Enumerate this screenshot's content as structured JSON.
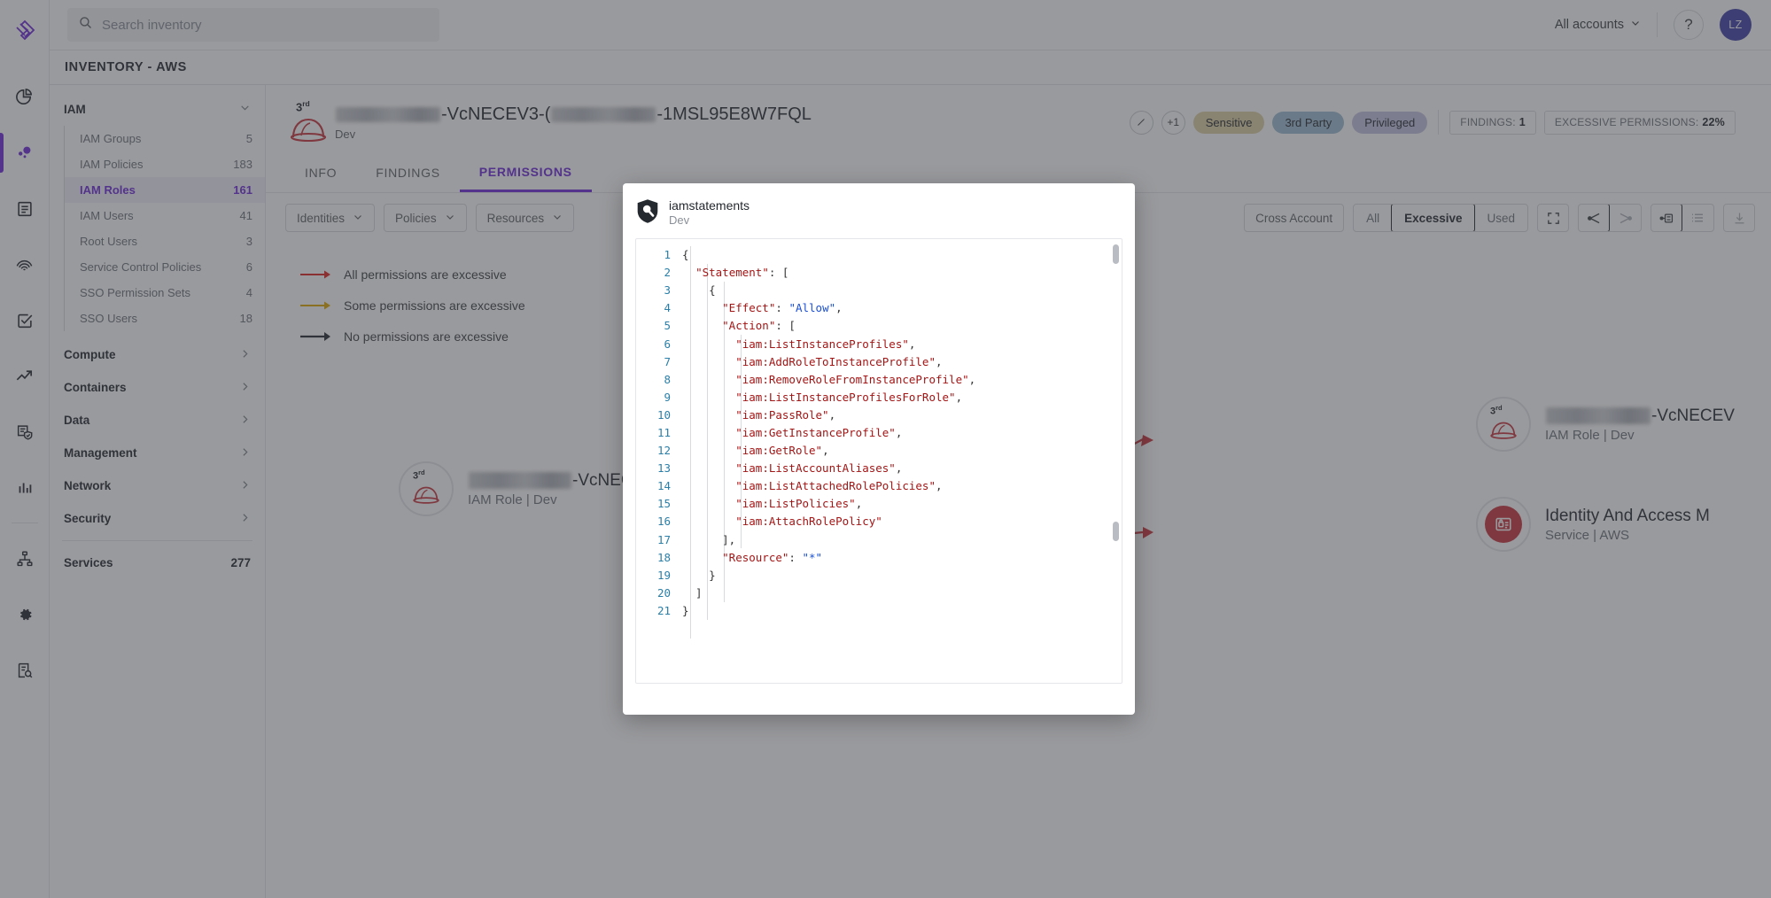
{
  "app": {
    "page_title": "INVENTORY - AWS",
    "logo_icon": "brand-logo-icon"
  },
  "search": {
    "placeholder": "Search inventory",
    "value": "",
    "icon": "search-icon"
  },
  "topbar": {
    "account_selector": "All accounts",
    "chevron_icon": "chevron-down-icon",
    "help_label": "?",
    "avatar_initials": "LZ"
  },
  "rail": {
    "items": [
      {
        "name": "pie-chart-icon",
        "active": false
      },
      {
        "name": "bubbles-icon",
        "active": true
      },
      {
        "name": "document-icon",
        "active": false
      },
      {
        "name": "fingerprint-icon",
        "active": false
      },
      {
        "name": "checkbox-icon",
        "active": false
      },
      {
        "name": "trending-up-icon",
        "active": false
      },
      {
        "name": "document-shield-icon",
        "active": false
      },
      {
        "name": "bar-chart-icon",
        "active": false
      },
      {
        "name": "sitemap-icon",
        "active": false
      },
      {
        "name": "gear-icon",
        "active": false
      },
      {
        "name": "document-search-icon",
        "active": false
      }
    ]
  },
  "sidebar": {
    "groups": [
      {
        "label": "IAM",
        "expanded": true,
        "chevron": "chevron-down-icon",
        "items": [
          {
            "label": "IAM Groups",
            "count": "5",
            "active": false
          },
          {
            "label": "IAM Policies",
            "count": "183",
            "active": false
          },
          {
            "label": "IAM Roles",
            "count": "161",
            "active": true
          },
          {
            "label": "IAM Users",
            "count": "41",
            "active": false
          },
          {
            "label": "Root Users",
            "count": "3",
            "active": false
          },
          {
            "label": "Service Control Policies",
            "count": "6",
            "active": false
          },
          {
            "label": "SSO Permission Sets",
            "count": "4",
            "active": false
          },
          {
            "label": "SSO Users",
            "count": "18",
            "active": false
          }
        ]
      },
      {
        "label": "Compute",
        "expanded": false,
        "chevron": "chevron-right-icon",
        "items": []
      },
      {
        "label": "Containers",
        "expanded": false,
        "chevron": "chevron-right-icon",
        "items": []
      },
      {
        "label": "Data",
        "expanded": false,
        "chevron": "chevron-right-icon",
        "items": []
      },
      {
        "label": "Management",
        "expanded": false,
        "chevron": "chevron-right-icon",
        "items": []
      },
      {
        "label": "Network",
        "expanded": false,
        "chevron": "chevron-right-icon",
        "items": []
      },
      {
        "label": "Security",
        "expanded": false,
        "chevron": "chevron-right-icon",
        "items": []
      }
    ],
    "footer": {
      "label": "Services",
      "count": "277"
    }
  },
  "entity": {
    "third_party_tag": "3rd",
    "icon": "third-party-role-icon",
    "name_part_1": "-VcNECEV3-",
    "name_part_2": "-1MSL95E8W7FQL",
    "subtitle": "Dev",
    "edit_icon": "pencil-icon",
    "more_count": "+1",
    "tags": [
      {
        "label": "Sensitive",
        "color": "#ded0a4"
      },
      {
        "label": "3rd Party",
        "color": "#9dbdd4"
      },
      {
        "label": "Privileged",
        "color": "#c5c3e4"
      }
    ],
    "stats": [
      {
        "label": "FINDINGS:",
        "value": "1"
      },
      {
        "label": "EXCESSIVE PERMISSIONS:",
        "value": "22%"
      }
    ]
  },
  "tabs": [
    {
      "label": "INFO",
      "active": false
    },
    {
      "label": "FINDINGS",
      "active": false
    },
    {
      "label": "PERMISSIONS",
      "active": true
    }
  ],
  "filters": {
    "dropdowns": [
      {
        "label": "Identities",
        "icon": "chevron-down-icon"
      },
      {
        "label": "Policies",
        "icon": "chevron-down-icon"
      },
      {
        "label": "Resources",
        "icon": "chevron-down-icon"
      }
    ],
    "cross_account": "Cross Account",
    "scope": [
      {
        "label": "All",
        "selected": false
      },
      {
        "label": "Excessive",
        "selected": true
      },
      {
        "label": "Used",
        "selected": false
      }
    ],
    "icons": [
      {
        "name": "expand-icon",
        "selected": false
      },
      {
        "name": "graph-fan-out-icon",
        "selected": true
      },
      {
        "name": "graph-fan-in-icon",
        "selected": false
      },
      {
        "name": "node-detail-icon",
        "selected": true
      },
      {
        "name": "list-view-icon",
        "selected": false
      },
      {
        "name": "download-icon",
        "selected": false
      }
    ]
  },
  "legend": [
    {
      "text": "All permissions are excessive",
      "color": "#e02020"
    },
    {
      "text": "Some permissions are excessive",
      "color": "#e0a800"
    },
    {
      "text": "No permissions are excessive",
      "color": "#24292f"
    }
  ],
  "graph_nodes": [
    {
      "tag": "3rd",
      "icon": "third-party-role-icon",
      "name": "-VcNECEV",
      "sub": "IAM Role | Dev"
    },
    {
      "icon": "iam-service-icon",
      "name": "Identity And Access M",
      "sub": "Service | AWS"
    }
  ],
  "modal": {
    "icon": "policy-shield-icon",
    "title": "iamstatements",
    "subtitle": "Dev",
    "highlight_line": 16,
    "lines": [
      {
        "n": "1",
        "tokens": [
          {
            "t": "{",
            "c": "p"
          }
        ]
      },
      {
        "n": "2",
        "tokens": [
          {
            "t": "  ",
            "c": "p"
          },
          {
            "t": "\"Statement\"",
            "c": "k"
          },
          {
            "t": ": [",
            "c": "p"
          }
        ]
      },
      {
        "n": "3",
        "tokens": [
          {
            "t": "    {",
            "c": "p"
          }
        ]
      },
      {
        "n": "4",
        "tokens": [
          {
            "t": "      ",
            "c": "p"
          },
          {
            "t": "\"Effect\"",
            "c": "k"
          },
          {
            "t": ": ",
            "c": "p"
          },
          {
            "t": "\"Allow\"",
            "c": "s"
          },
          {
            "t": ",",
            "c": "p"
          }
        ]
      },
      {
        "n": "5",
        "tokens": [
          {
            "t": "      ",
            "c": "p"
          },
          {
            "t": "\"Action\"",
            "c": "k"
          },
          {
            "t": ": [",
            "c": "p"
          }
        ]
      },
      {
        "n": "6",
        "tokens": [
          {
            "t": "        ",
            "c": "p"
          },
          {
            "t": "\"iam:ListInstanceProfiles\"",
            "c": "k"
          },
          {
            "t": ",",
            "c": "p"
          }
        ]
      },
      {
        "n": "7",
        "tokens": [
          {
            "t": "        ",
            "c": "p"
          },
          {
            "t": "\"iam:AddRoleToInstanceProfile\"",
            "c": "k"
          },
          {
            "t": ",",
            "c": "p"
          }
        ]
      },
      {
        "n": "8",
        "tokens": [
          {
            "t": "        ",
            "c": "p"
          },
          {
            "t": "\"iam:RemoveRoleFromInstanceProfile\"",
            "c": "k"
          },
          {
            "t": ",",
            "c": "p"
          }
        ]
      },
      {
        "n": "9",
        "tokens": [
          {
            "t": "        ",
            "c": "p"
          },
          {
            "t": "\"iam:ListInstanceProfilesForRole\"",
            "c": "k"
          },
          {
            "t": ",",
            "c": "p"
          }
        ]
      },
      {
        "n": "10",
        "tokens": [
          {
            "t": "        ",
            "c": "p"
          },
          {
            "t": "\"iam:PassRole\"",
            "c": "k"
          },
          {
            "t": ",",
            "c": "p"
          }
        ]
      },
      {
        "n": "11",
        "tokens": [
          {
            "t": "        ",
            "c": "p"
          },
          {
            "t": "\"iam:GetInstanceProfile\"",
            "c": "k"
          },
          {
            "t": ",",
            "c": "p"
          }
        ]
      },
      {
        "n": "12",
        "tokens": [
          {
            "t": "        ",
            "c": "p"
          },
          {
            "t": "\"iam:GetRole\"",
            "c": "k"
          },
          {
            "t": ",",
            "c": "p"
          }
        ]
      },
      {
        "n": "13",
        "tokens": [
          {
            "t": "        ",
            "c": "p"
          },
          {
            "t": "\"iam:ListAccountAliases\"",
            "c": "k"
          },
          {
            "t": ",",
            "c": "p"
          }
        ]
      },
      {
        "n": "14",
        "tokens": [
          {
            "t": "        ",
            "c": "p"
          },
          {
            "t": "\"iam:ListAttachedRolePolicies\"",
            "c": "k"
          },
          {
            "t": ",",
            "c": "p"
          }
        ]
      },
      {
        "n": "15",
        "tokens": [
          {
            "t": "        ",
            "c": "p"
          },
          {
            "t": "\"iam:ListPolicies\"",
            "c": "k"
          },
          {
            "t": ",",
            "c": "p"
          }
        ]
      },
      {
        "n": "16",
        "tokens": [
          {
            "t": "        ",
            "c": "p"
          },
          {
            "t": "\"iam:AttachRolePolicy\"",
            "c": "k"
          }
        ]
      },
      {
        "n": "17",
        "tokens": [
          {
            "t": "      ],",
            "c": "p"
          }
        ]
      },
      {
        "n": "18",
        "tokens": [
          {
            "t": "      ",
            "c": "p"
          },
          {
            "t": "\"Resource\"",
            "c": "k"
          },
          {
            "t": ": ",
            "c": "p"
          },
          {
            "t": "\"*\"",
            "c": "s"
          }
        ]
      },
      {
        "n": "19",
        "tokens": [
          {
            "t": "    }",
            "c": "p"
          }
        ]
      },
      {
        "n": "20",
        "tokens": [
          {
            "t": "  ]",
            "c": "p"
          }
        ]
      },
      {
        "n": "21",
        "tokens": [
          {
            "t": "}",
            "c": "p"
          }
        ]
      }
    ]
  },
  "colors": {
    "accent": "#6d28d9",
    "danger": "#e02020",
    "warning": "#e0a800",
    "neutral": "#24292f"
  }
}
